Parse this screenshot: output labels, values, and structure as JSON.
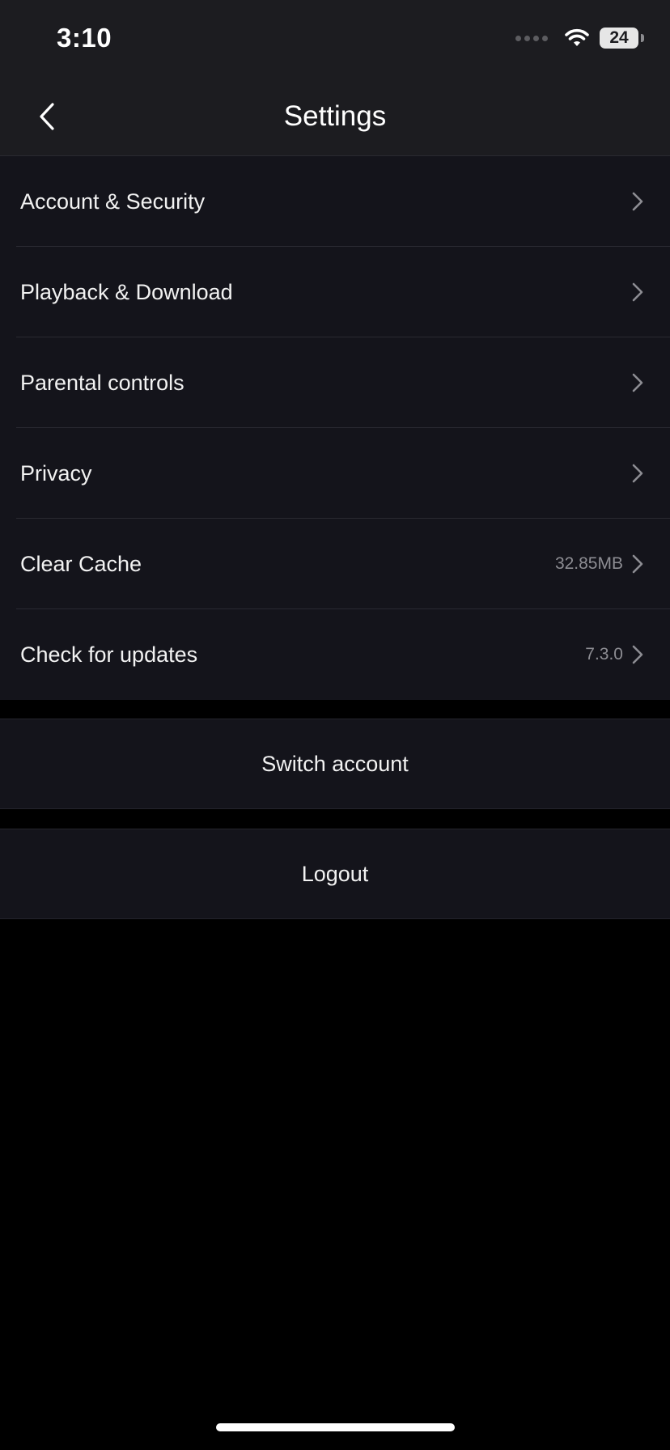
{
  "status_bar": {
    "time": "3:10",
    "battery": "24",
    "wifi_icon": "wifi-icon",
    "signal_icon": "cellular-signal-icon"
  },
  "header": {
    "title": "Settings",
    "back_icon": "chevron-left-icon"
  },
  "menu": {
    "items": [
      {
        "label": "Account & Security",
        "value": ""
      },
      {
        "label": "Playback & Download",
        "value": ""
      },
      {
        "label": "Parental controls",
        "value": ""
      },
      {
        "label": "Privacy",
        "value": ""
      },
      {
        "label": "Clear Cache",
        "value": "32.85MB"
      },
      {
        "label": "Check for updates",
        "value": "7.3.0"
      }
    ]
  },
  "actions": {
    "switch_account": "Switch account",
    "logout": "Logout"
  },
  "colors": {
    "background": "#000000",
    "bar_background": "#1c1c20",
    "row_background": "#14141b",
    "secondary_text": "#8d8d93"
  }
}
